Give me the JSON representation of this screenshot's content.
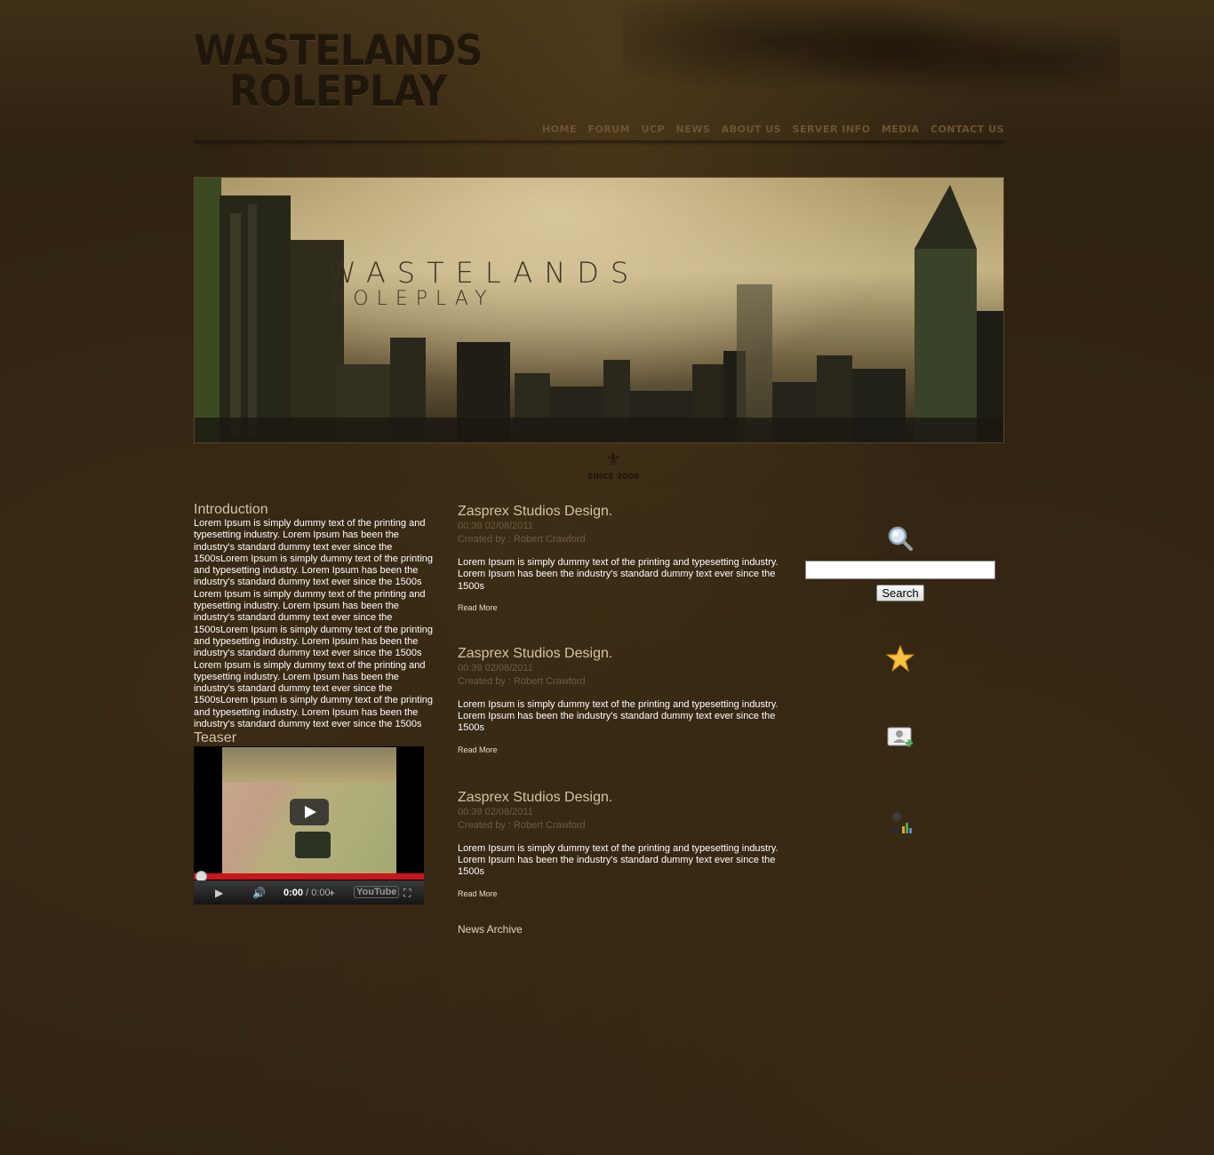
{
  "site": {
    "logo_line1": "WASTELANDS",
    "logo_line2": "ROLEPLAY"
  },
  "nav": {
    "items": [
      "HOME",
      "FORUM",
      "UCP",
      "NEWS",
      "ABOUT US",
      "SERVER INFO",
      "MEDIA",
      "CONTACT US"
    ]
  },
  "banner": {
    "title": "WASTELANDS",
    "subtitle": "ROLEPLAY"
  },
  "emblem": {
    "text": "SINCE 2008"
  },
  "intro": {
    "title": "Introduction",
    "paragraphs": [
      "Lorem Ipsum is simply dummy text of the printing and typesetting industry. Lorem Ipsum has been the industry's standard dummy text ever since the 1500sLorem Ipsum is simply dummy text of the printing and typesetting industry. Lorem Ipsum has been the industry's standard dummy text ever since the 1500s",
      "Lorem Ipsum is simply dummy text of the printing and typesetting industry. Lorem Ipsum has been the industry's standard dummy text ever since the 1500sLorem Ipsum is simply dummy text of the printing and typesetting industry. Lorem Ipsum has been the industry's standard dummy text ever since the 1500s",
      "Lorem Ipsum is simply dummy text of the printing and typesetting industry. Lorem Ipsum has been the industry's standard dummy text ever since the 1500sLorem Ipsum is simply dummy text of the printing and typesetting industry. Lorem Ipsum has been the industry's standard dummy text ever since the 1500s"
    ]
  },
  "teaser": {
    "title": "Teaser",
    "video": {
      "time_current": "0:00",
      "time_total": "/ 0:00",
      "progress": 0,
      "brand": "YouTube"
    }
  },
  "news": {
    "items": [
      {
        "title": "Zasprex Studios Design.",
        "date": "00:39 02/08/2011",
        "author": "Created by : Robert Crawford",
        "body": "Lorem Ipsum is simply dummy text of the printing and typesetting industry. Lorem Ipsum has been the industry's standard dummy text ever since the 1500s",
        "read_more": "Read More"
      },
      {
        "title": "Zasprex Studios Design.",
        "date": "00:39 02/08/2011",
        "author": "Created by : Robert Crawford",
        "body": "Lorem Ipsum is simply dummy text of the printing and typesetting industry. Lorem Ipsum has been the industry's standard dummy text ever since the 1500s",
        "read_more": "Read More"
      },
      {
        "title": "Zasprex Studios Design.",
        "date": "00:39 02/08/2011",
        "author": "Created by : Robert Crawford",
        "body": "Lorem Ipsum is simply dummy text of the printing and typesetting industry. Lorem Ipsum has been the industry's standard dummy text ever since the 1500s",
        "read_more": "Read More"
      }
    ],
    "archive_link": "News Archive"
  },
  "sidebar": {
    "search_value": "",
    "search_button": "Search",
    "icons": [
      "magnifier-icon",
      "star-icon",
      "add-user-icon",
      "user-stats-icon"
    ]
  },
  "colors": {
    "background": "#2e2211",
    "nav_text": "#6d5433",
    "heading": "#d4c3a3",
    "meta": "#6e5d42",
    "body_text": "#ffffff",
    "progress_bar": "#c8161a"
  }
}
